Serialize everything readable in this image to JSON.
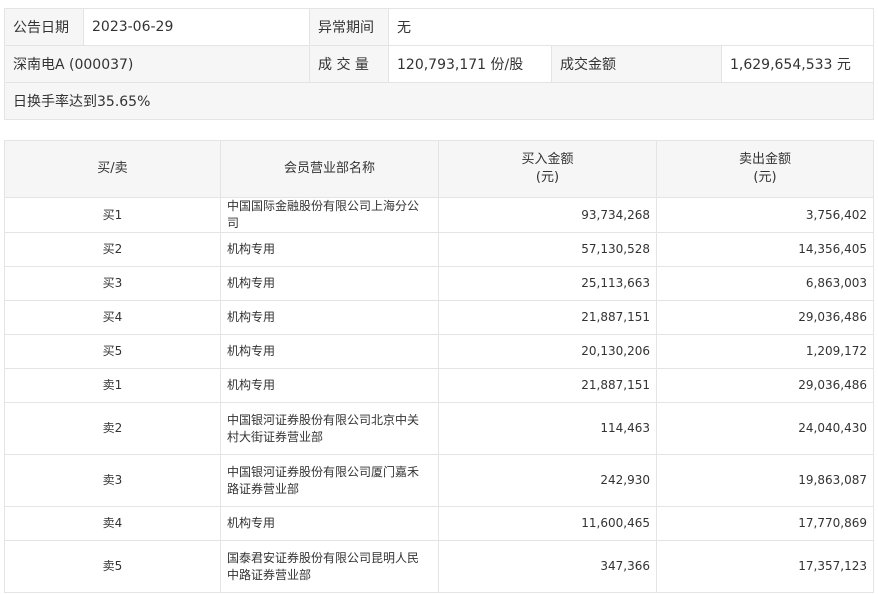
{
  "summary": {
    "date_label": "公告日期",
    "date_value": "2023-06-29",
    "period_label": "异常期间",
    "period_value": "无",
    "stock": "深南电A (000037)",
    "volume_label": "成 交 量",
    "volume_value": "120,793,171 份/股",
    "amount_label": "成交金额",
    "amount_value": "1,629,654,533 元",
    "reason": "日换手率达到35.65%"
  },
  "table": {
    "headers": {
      "side": "买/卖",
      "dept": "会员营业部名称",
      "buy_line1": "买入金额",
      "buy_line2": "(元)",
      "sell_line1": "卖出金额",
      "sell_line2": "(元)"
    },
    "rows": [
      {
        "side": "买1",
        "dept": "中国国际金融股份有限公司上海分公司",
        "buy": "93,734,268",
        "sell": "3,756,402"
      },
      {
        "side": "买2",
        "dept": "机构专用",
        "buy": "57,130,528",
        "sell": "14,356,405"
      },
      {
        "side": "买3",
        "dept": "机构专用",
        "buy": "25,113,663",
        "sell": "6,863,003"
      },
      {
        "side": "买4",
        "dept": "机构专用",
        "buy": "21,887,151",
        "sell": "29,036,486"
      },
      {
        "side": "买5",
        "dept": "机构专用",
        "buy": "20,130,206",
        "sell": "1,209,172"
      },
      {
        "side": "卖1",
        "dept": "机构专用",
        "buy": "21,887,151",
        "sell": "29,036,486"
      },
      {
        "side": "卖2",
        "dept": "中国银河证券股份有限公司北京中关村大街证券营业部",
        "buy": "114,463",
        "sell": "24,040,430"
      },
      {
        "side": "卖3",
        "dept": "中国银河证券股份有限公司厦门嘉禾路证券营业部",
        "buy": "242,930",
        "sell": "19,863,087"
      },
      {
        "side": "卖4",
        "dept": "机构专用",
        "buy": "11,600,465",
        "sell": "17,770,869"
      },
      {
        "side": "卖5",
        "dept": "国泰君安证券股份有限公司昆明人民中路证券营业部",
        "buy": "347,366",
        "sell": "17,357,123"
      }
    ]
  }
}
